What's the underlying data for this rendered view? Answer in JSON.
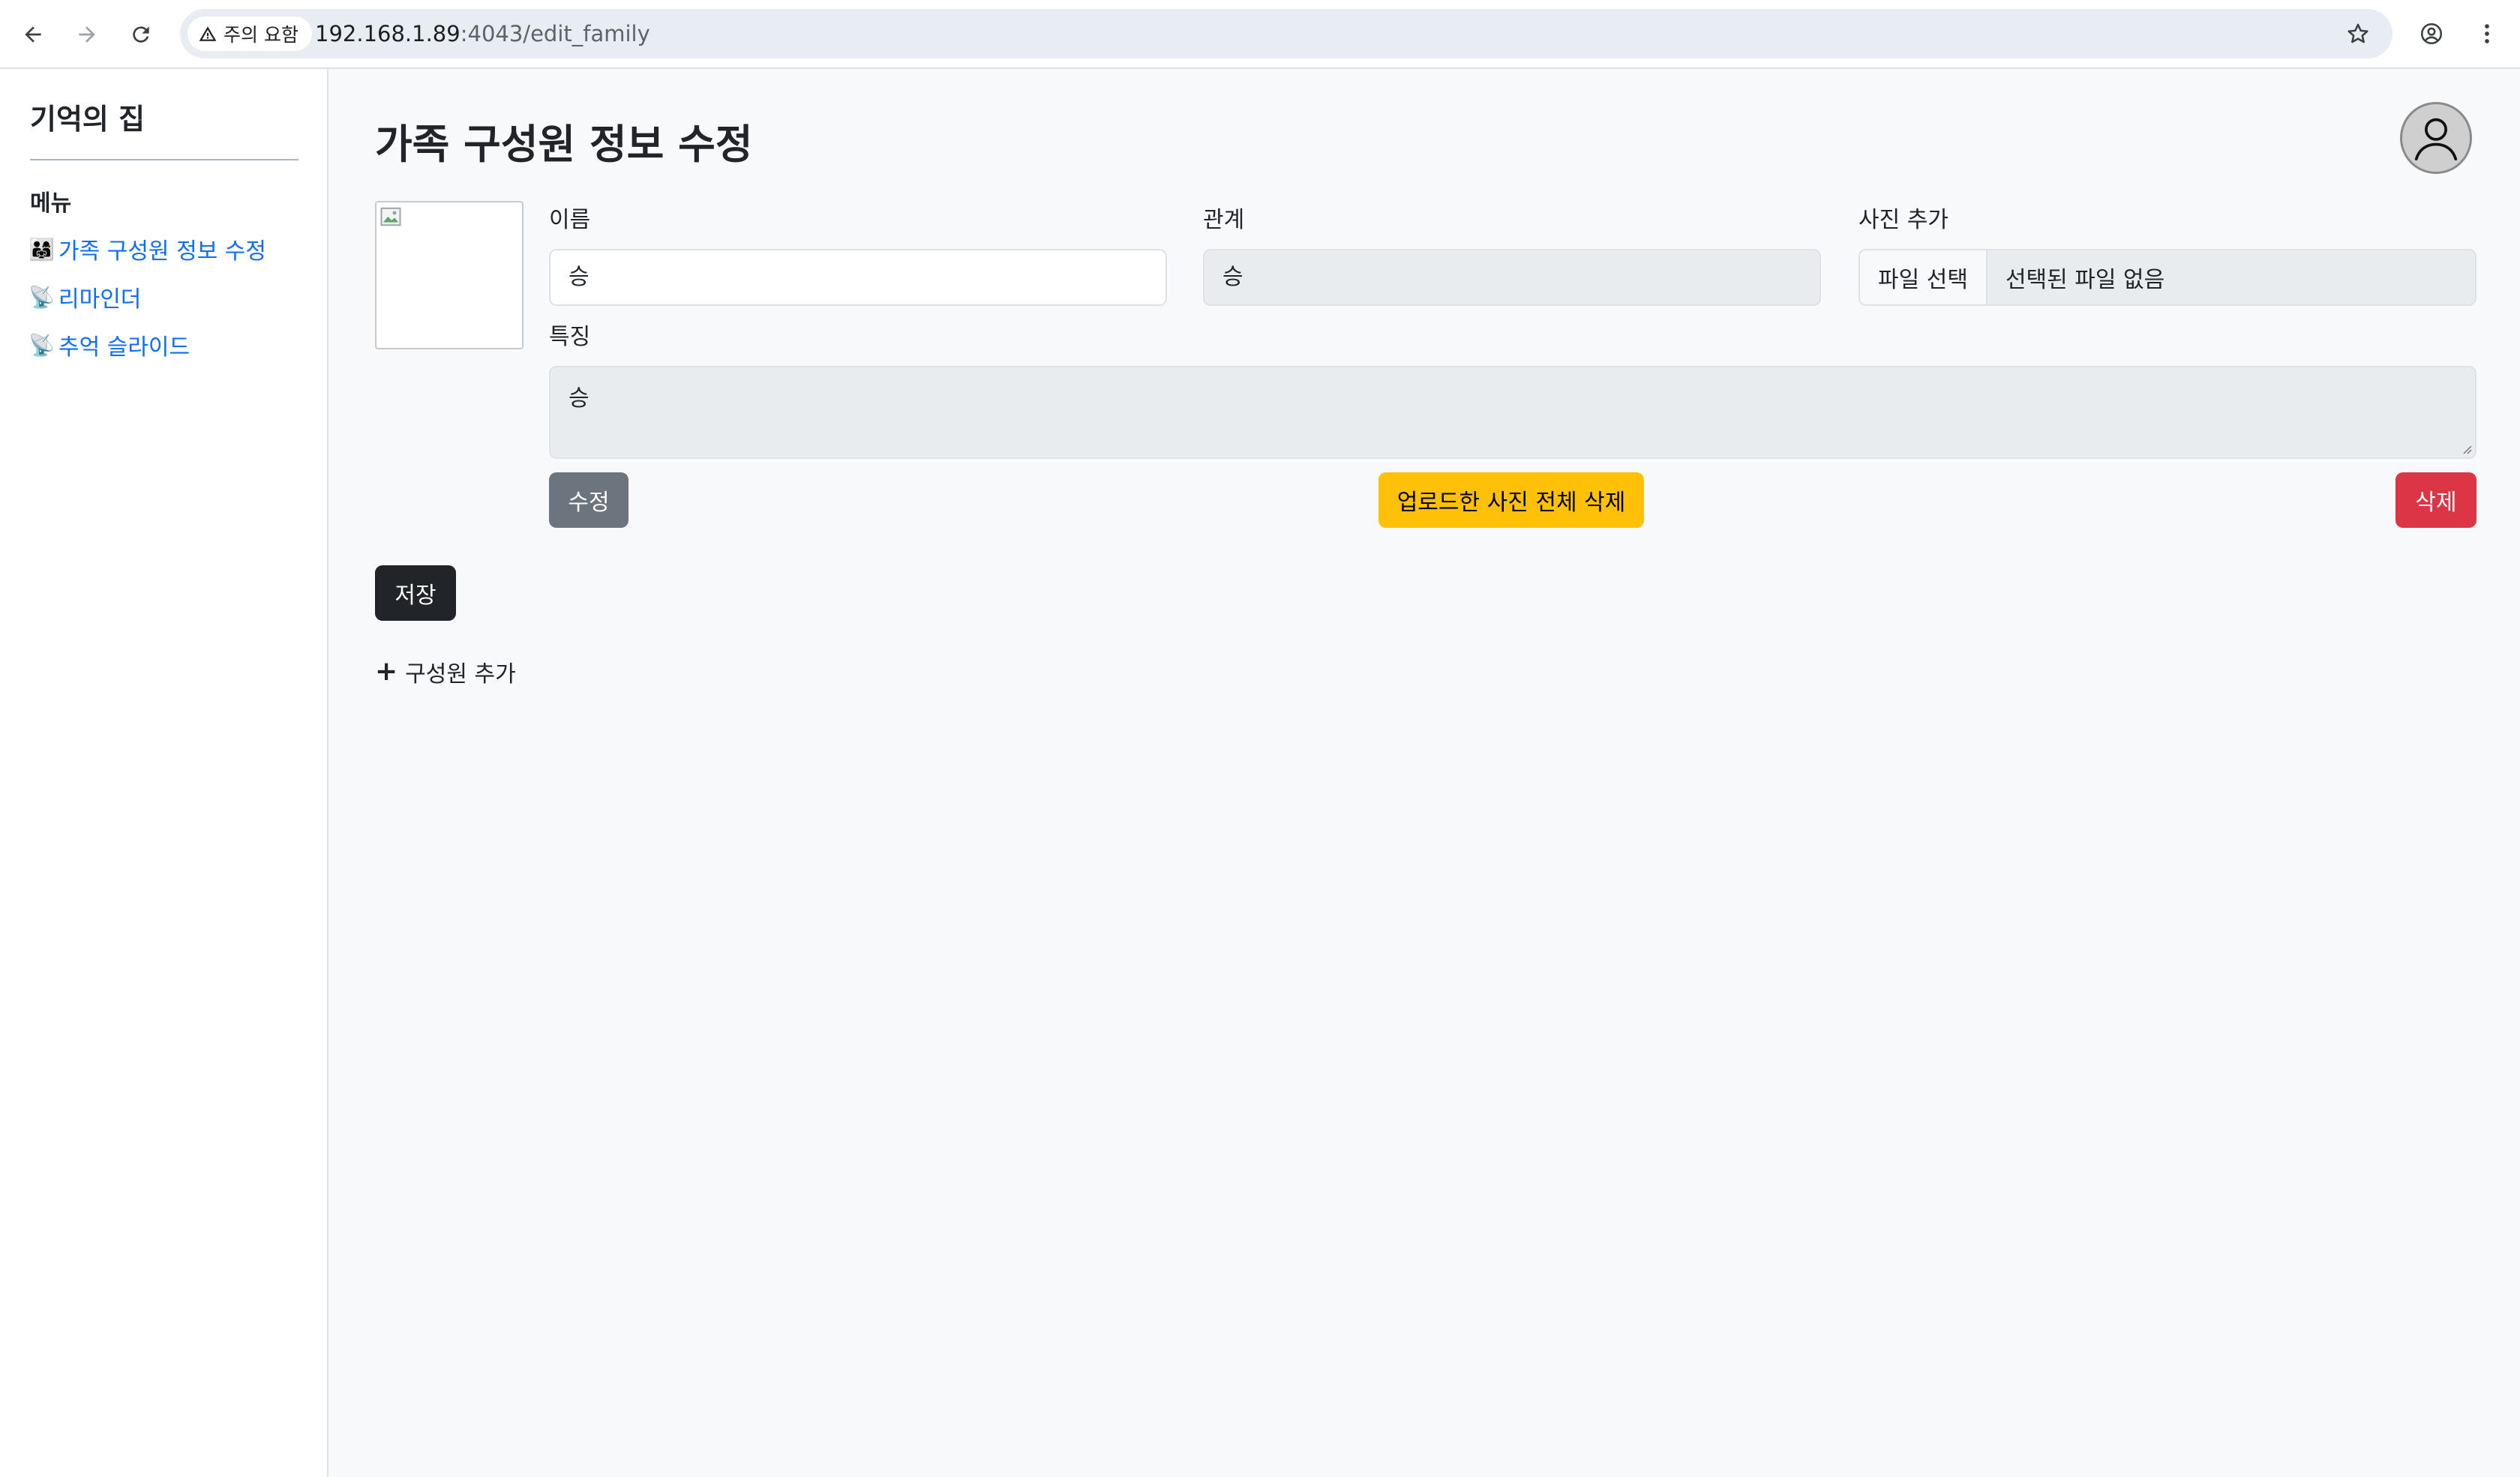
{
  "browser": {
    "security_label": "주의 요함",
    "url_host": "192.168.1.89",
    "url_path": ":4043/edit_family"
  },
  "sidebar": {
    "brand": "기억의 집",
    "menu_title": "메뉴",
    "items": [
      {
        "emoji": "👨‍👩‍👧",
        "label": "가족 구성원 정보 수정"
      },
      {
        "emoji": "📡",
        "label": "리마인더"
      },
      {
        "emoji": "📡",
        "label": "추억 슬라이드"
      }
    ]
  },
  "main": {
    "title": "가족 구성원 정보 수정",
    "member": {
      "name_label": "이름",
      "name_value": "승",
      "relation_label": "관계",
      "relation_value": "승",
      "photo_label": "사진 추가",
      "file_button": "파일 선택",
      "file_status": "선택된 파일 없음",
      "feature_label": "특징",
      "feature_value": "승",
      "edit_button": "수정",
      "delete_photos_button": "업로드한 사진 전체 삭제",
      "delete_button": "삭제"
    },
    "save_button": "저장",
    "add_member": "구성원 추가"
  }
}
